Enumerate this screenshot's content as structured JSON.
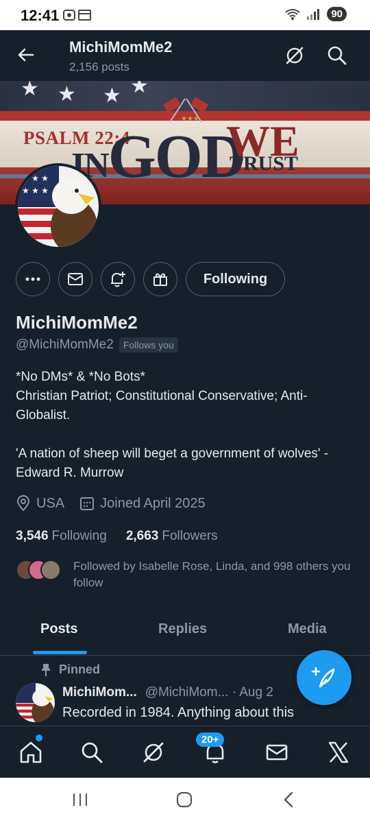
{
  "status_bar": {
    "time": "12:41",
    "battery": "90"
  },
  "header": {
    "name": "MichiMomMe2",
    "posts": "2,156 posts"
  },
  "banner": {
    "psalm": "PSALM 22:4",
    "in": "IN",
    "god": "GOD",
    "we": "WE",
    "trust": "TRUST"
  },
  "actions": {
    "following_label": "Following"
  },
  "profile": {
    "display_name": "MichiMomMe2",
    "handle": "@MichiMomMe2",
    "follows_you": "Follows you",
    "bio": "*No DMs* & *No Bots*\nChristian Patriot; Constitutional Conservative; Anti-Globalist.\n\n'A nation of sheep will beget a government of wolves' -Edward R. Murrow",
    "location": "USA",
    "joined": "Joined April 2025",
    "following_count": "3,546",
    "following_label": "Following",
    "followers_count": "2,663",
    "followers_label": "Followers",
    "followed_by": "Followed by Isabelle Rose, Linda, and 998 others you follow"
  },
  "tabs": [
    "Posts",
    "Replies",
    "Media"
  ],
  "pinned_tweet": {
    "pinned_label": "Pinned",
    "name": "MichiMom...",
    "handle_date": "@MichiMom... · Aug 2",
    "text": "Recorded in 1984. Anything about this"
  },
  "bottom_nav": {
    "notifications_badge": "20+"
  },
  "colors": {
    "background": "#15202b",
    "accent": "#1d9bf0",
    "muted": "#8b98a5",
    "text": "#e7e9ea"
  }
}
